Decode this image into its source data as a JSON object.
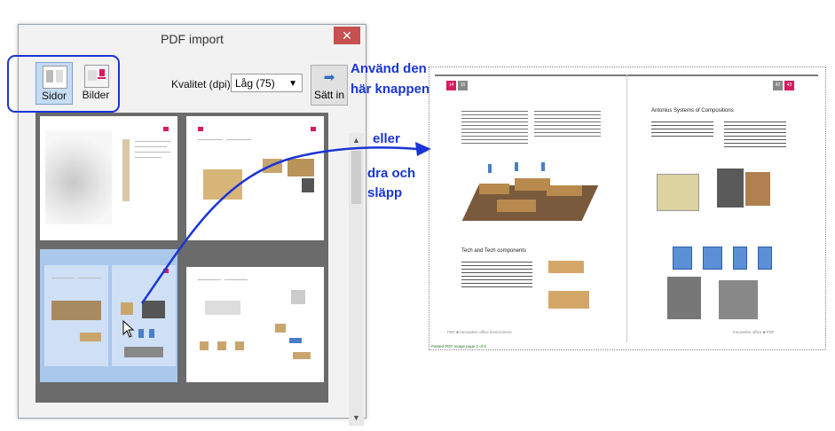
{
  "dialog": {
    "title": "PDF import",
    "close_label": "✕",
    "mode_pages_label": "Sidor",
    "mode_images_label": "Bilder",
    "quality_label": "Kvalitet (dpi)",
    "quality_value": "Låg (75)",
    "insert_label": "Sätt in",
    "scroll_up": "▲",
    "scroll_down": "▼"
  },
  "annotations": {
    "line1": "Använd den",
    "line2": "här knappen",
    "or": "eller",
    "drag1": "dra och",
    "drag2": "släpp"
  },
  "preview": {
    "left_page_num": "14",
    "left_page_num2": "15",
    "right_page_num": "42",
    "right_page_num2": "43",
    "left_heading": "Tech and Tech components",
    "right_heading": "Antonius Systems of Compositions",
    "left_footer": "PDF ■ Innovative office environment",
    "right_footer": "Innovative office ■ PDF",
    "frame_label": "Pasted PDF Image page 1 of 8"
  },
  "colors": {
    "accent_red": "#d81b60",
    "annotation_blue": "#1a35d6",
    "selection_blue": "#a9c8ec"
  }
}
